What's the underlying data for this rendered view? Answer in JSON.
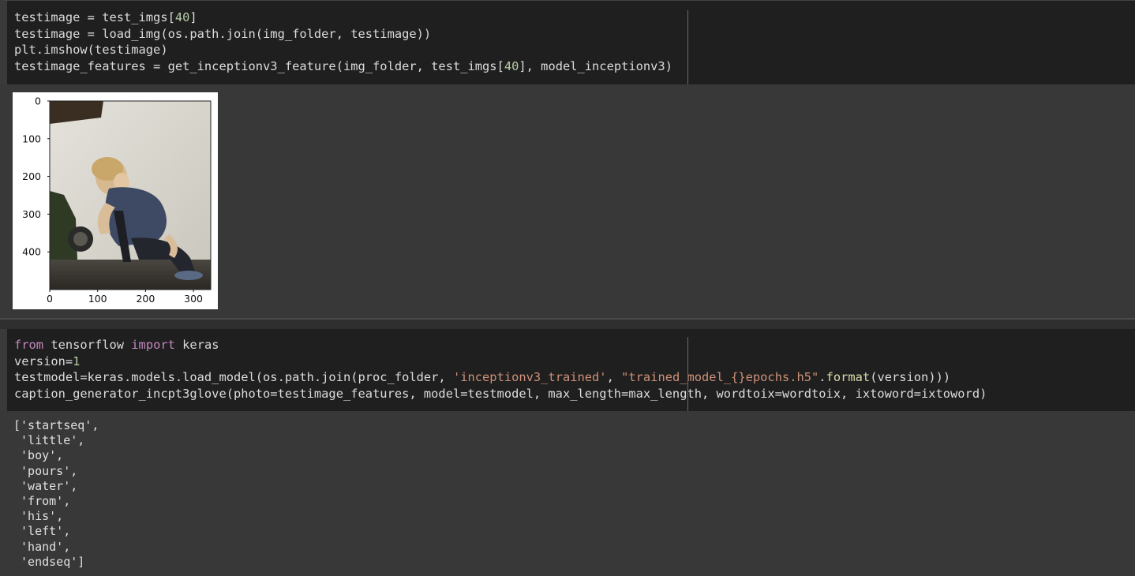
{
  "cells": {
    "cell1": {
      "code": {
        "l1_a": "testimage = test_imgs[",
        "l1_n": "40",
        "l1_b": "]",
        "l2": "testimage = load_img(os.path.join(img_folder, testimage))",
        "l3": "plt.imshow(testimage)",
        "l4_a": "testimage_features = get_inceptionv3_feature(img_folder, test_imgs[",
        "l4_n": "40",
        "l4_b": "], model_inceptionv3)"
      },
      "plot": {
        "y_ticks": [
          "0",
          "100",
          "200",
          "300",
          "400"
        ],
        "x_ticks": [
          "0",
          "100",
          "200",
          "300"
        ],
        "image_subject": "toddler crouching by a wall with hand to mouth"
      }
    },
    "cell2": {
      "code": {
        "l1_kw1": "from",
        "l1_mid": " tensorflow ",
        "l1_kw2": "import",
        "l1_end": " keras",
        "l2_a": "version=",
        "l2_n": "1",
        "l3_a": "testmodel=keras.models.load_model(os.path.join(proc_folder, ",
        "l3_s1": "'inceptionv3_trained'",
        "l3_c": ", ",
        "l3_s2": "\"trained_model_{}epochs.h5\"",
        "l3_d": ".",
        "l3_fn": "format",
        "l3_e": "(version)))",
        "l4": "caption_generator_incpt3glove(photo=testimage_features, model=testmodel, max_length=max_length, wordtoix=wordtoix, ixtoword=ixtoword)"
      },
      "output_lines": [
        "['startseq',",
        " 'little',",
        " 'boy',",
        " 'pours',",
        " 'water',",
        " 'from',",
        " 'his',",
        " 'left',",
        " 'hand',",
        " 'endseq']"
      ]
    }
  },
  "colors": {
    "code_bg": "#1f1f1f",
    "output_bg": "#383838",
    "number": "#b5cea8",
    "keyword": "#c586c0",
    "string": "#ce9178",
    "function": "#dcdcaa"
  }
}
